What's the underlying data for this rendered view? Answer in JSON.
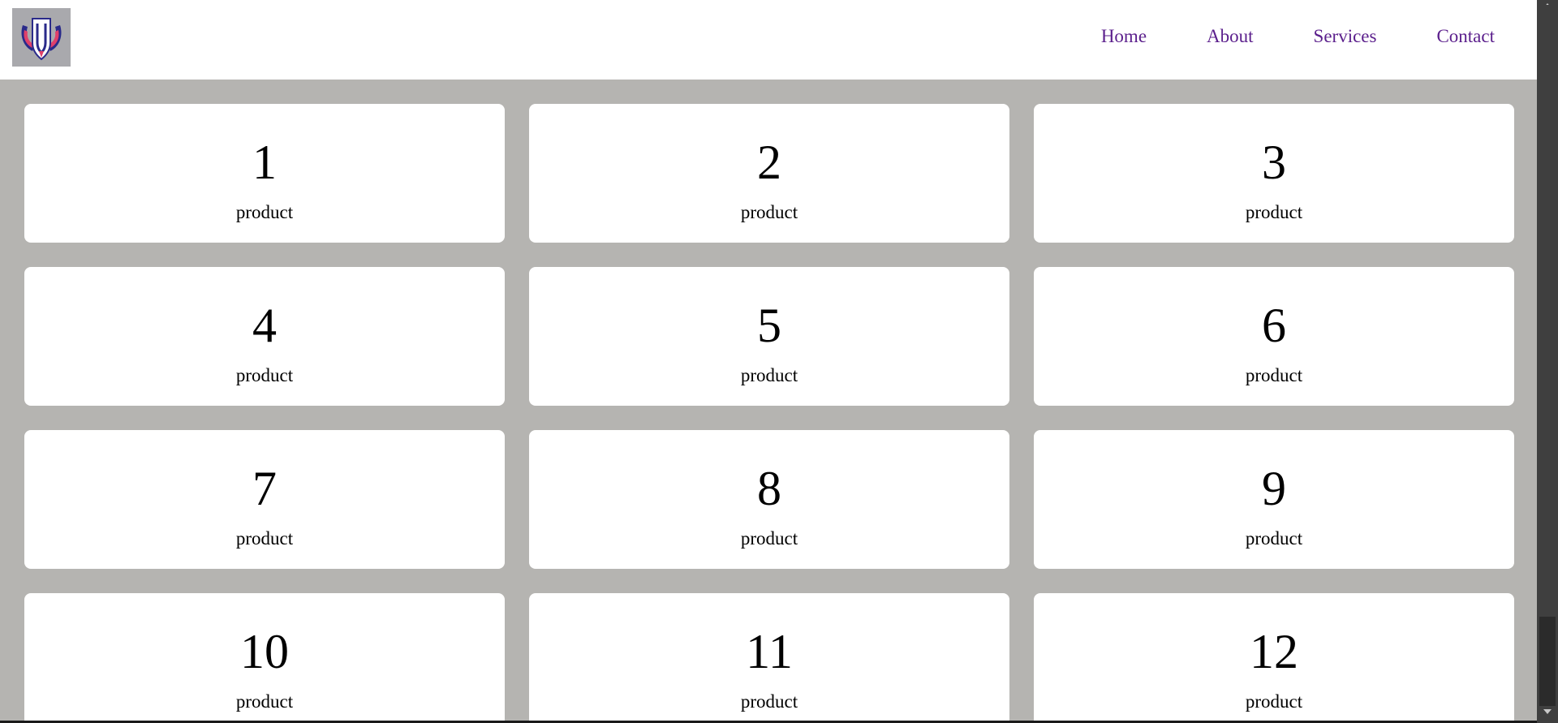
{
  "header": {
    "logo_icon": "winged-shield-logo-icon",
    "nav": [
      {
        "label": "Home"
      },
      {
        "label": "About"
      },
      {
        "label": "Services"
      },
      {
        "label": "Contact"
      }
    ],
    "nav_color": "#5b1f8c"
  },
  "colors": {
    "page_background": "#b5b4b1",
    "card_background": "#ffffff"
  },
  "products": [
    {
      "number": "1",
      "label": "product"
    },
    {
      "number": "2",
      "label": "product"
    },
    {
      "number": "3",
      "label": "product"
    },
    {
      "number": "4",
      "label": "product"
    },
    {
      "number": "5",
      "label": "product"
    },
    {
      "number": "6",
      "label": "product"
    },
    {
      "number": "7",
      "label": "product"
    },
    {
      "number": "8",
      "label": "product"
    },
    {
      "number": "9",
      "label": "product"
    },
    {
      "number": "10",
      "label": "product"
    },
    {
      "number": "11",
      "label": "product"
    },
    {
      "number": "12",
      "label": "product"
    }
  ]
}
